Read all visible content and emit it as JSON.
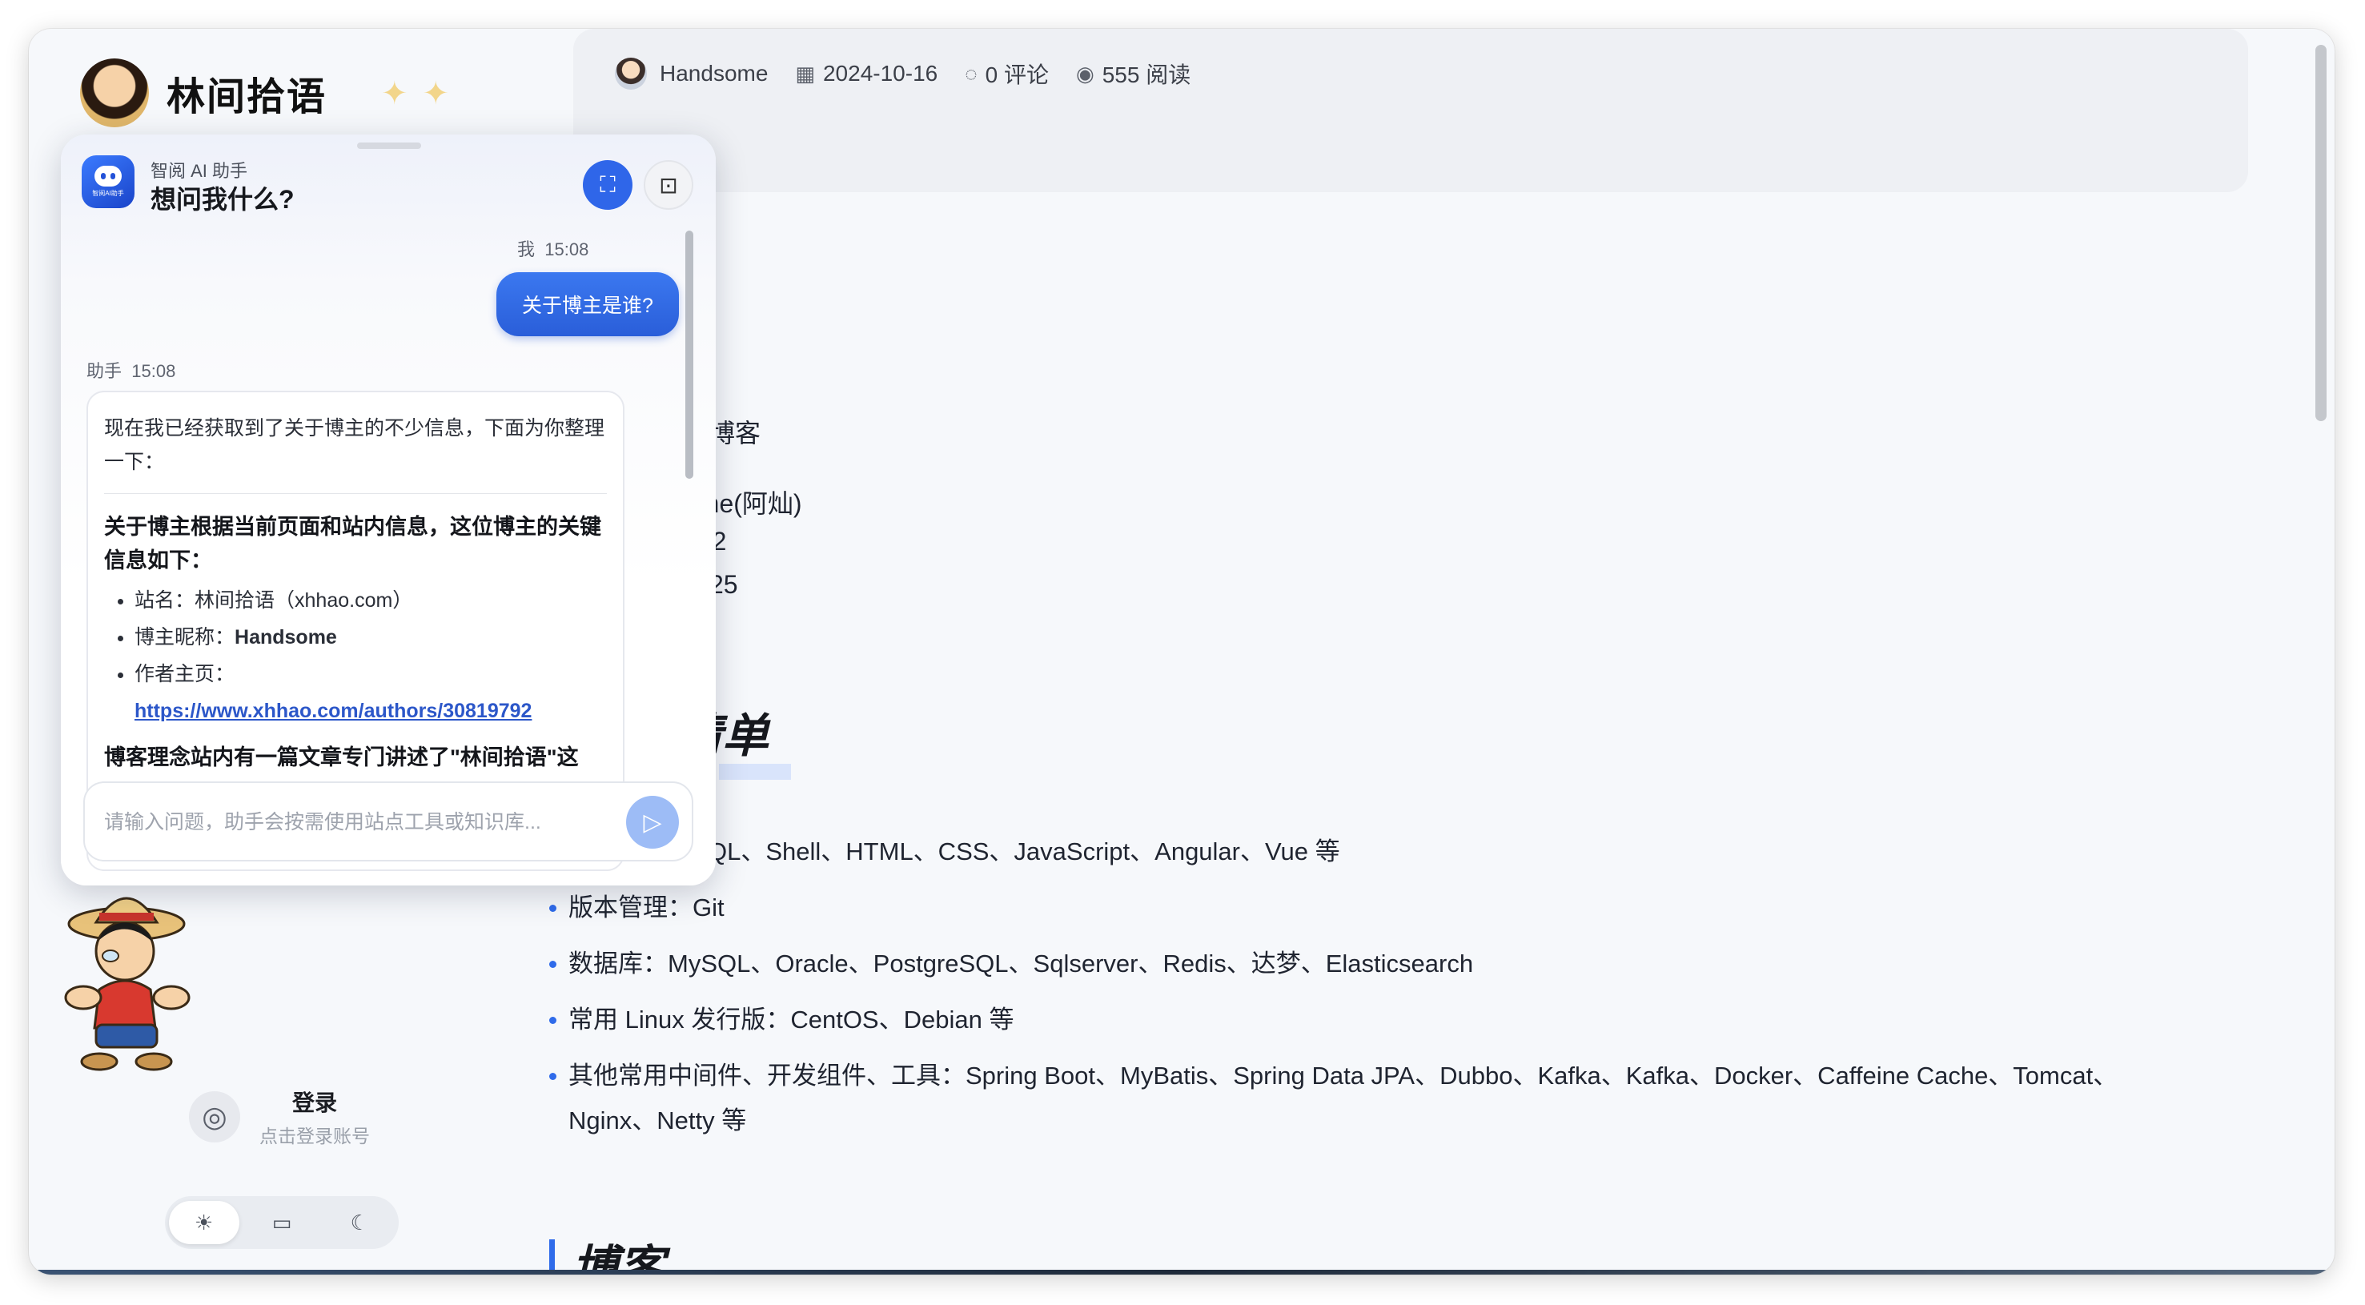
{
  "site": {
    "name": "林间拾语"
  },
  "meta": {
    "author": "Handsome",
    "date": "2024-10-16",
    "comments": "0 评论",
    "views": "555 阅读"
  },
  "content": {
    "frag_blog": "的博客",
    "frag_name": "ome(阿灿)",
    "frag_id": "792",
    "frag_code": "B-25",
    "section_skills": "清单",
    "section_blog": "博客",
    "skills": [
      "ava、Go、SQL、Shell、HTML、CSS、JavaScript、Angular、Vue 等",
      "版本管理：Git",
      "数据库：MySQL、Oracle、PostgreSQL、Sqlserver、Redis、达梦、Elasticsearch",
      "常用 Linux 发行版：CentOS、Debian 等",
      "其他常用中间件、开发组件、工具：Spring Boot、MyBatis、Spring Data JPA、Dubbo、Kafka、Kafka、Docker、Caffeine Cache、Tomcat、Nginx、Netty 等"
    ]
  },
  "sidebar": {
    "login_title": "登录",
    "login_sub": "点击登录账号"
  },
  "chat": {
    "assistant_name": "智阅 AI 助手",
    "logo_text": "智阅AI助手",
    "title": "想问我什么?",
    "me_label": "我",
    "me_time": "15:08",
    "me_message": "关于博主是谁?",
    "bot_label": "助手",
    "bot_time": "15:08",
    "bot_intro": "现在我已经获取到了关于博主的不少信息，下面为你整理一下：",
    "bot_heading": "关于博主根据当前页面和站内信息，这位博主的关键信息如下：",
    "bot_item1_label": "站名：",
    "bot_item1_value": "林间拾语（xhhao.com）",
    "bot_item2_label": "博主昵称：",
    "bot_item2_value": "Handsome",
    "bot_item3_label": "作者主页：",
    "bot_item3_link": "https://www.xhhao.com/authors/30819792",
    "bot_tail": "博客理念站内有一篇文章专门讲述了\"林间拾语\"这",
    "input_placeholder": "请输入问题，助手会按需使用站点工具或知识库..."
  },
  "colors": {
    "accent": "#2f66e9",
    "bullet": "#2f6bea"
  }
}
